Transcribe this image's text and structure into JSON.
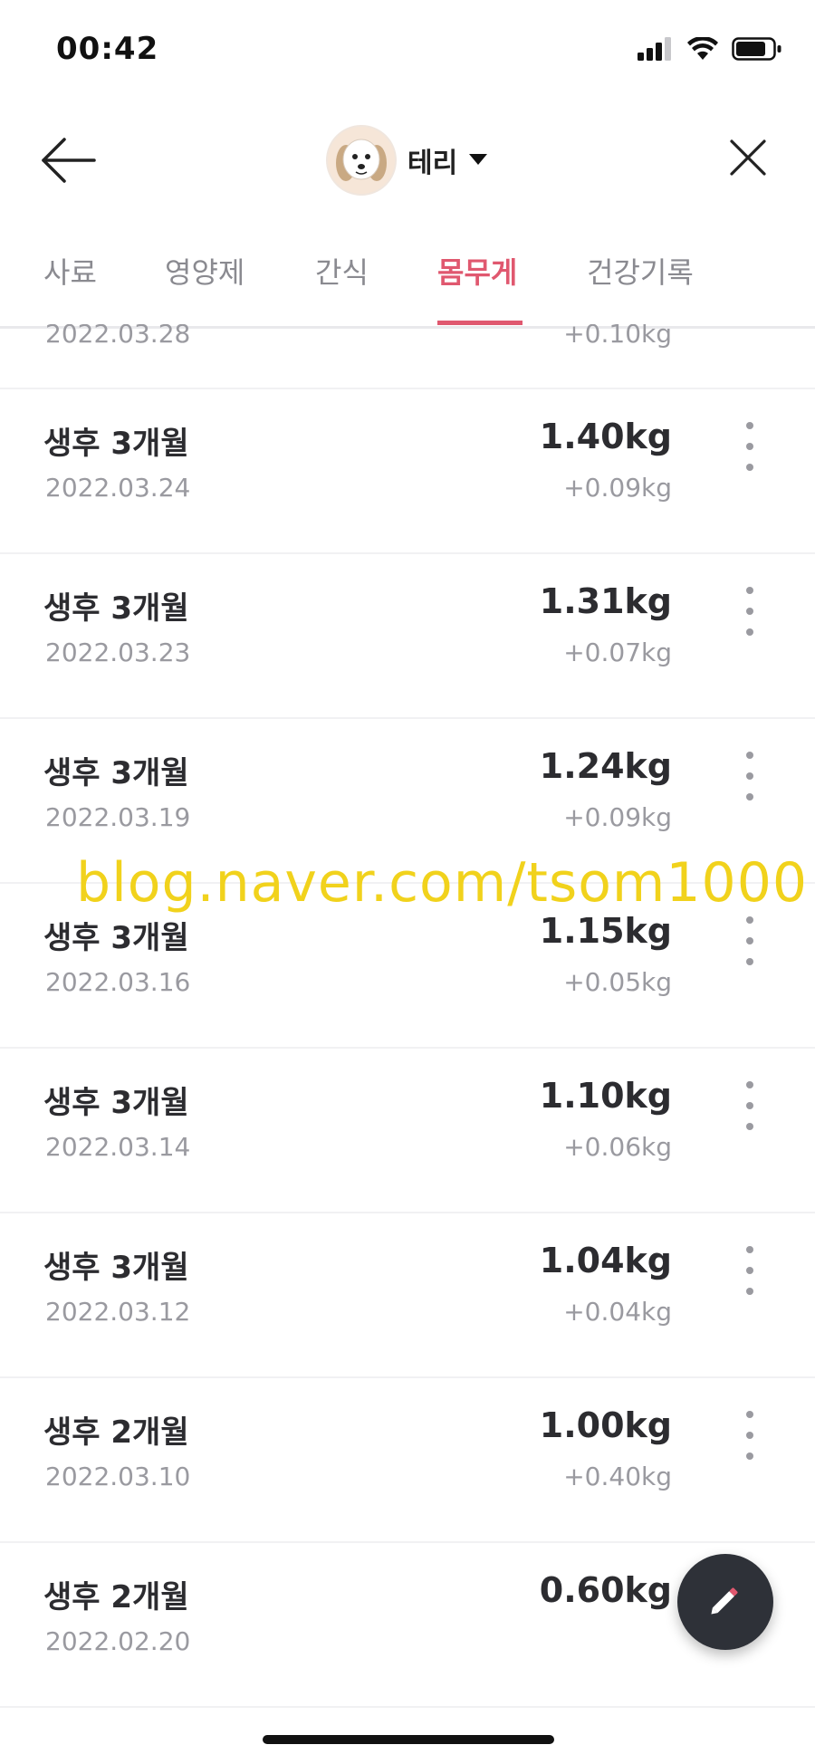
{
  "status_bar": {
    "time": "00:42"
  },
  "header": {
    "pet_name": "테리"
  },
  "tabs": [
    {
      "label": "사료",
      "active": false
    },
    {
      "label": "영양제",
      "active": false
    },
    {
      "label": "간식",
      "active": false
    },
    {
      "label": "몸무게",
      "active": true
    },
    {
      "label": "건강기록",
      "active": false
    }
  ],
  "partial_record": {
    "date": "2022.03.28",
    "change": "+0.10kg"
  },
  "records": [
    {
      "age": "생후 3개월",
      "date": "2022.03.24",
      "weight": "1.40kg",
      "change": "+0.09kg"
    },
    {
      "age": "생후 3개월",
      "date": "2022.03.23",
      "weight": "1.31kg",
      "change": "+0.07kg"
    },
    {
      "age": "생후 3개월",
      "date": "2022.03.19",
      "weight": "1.24kg",
      "change": "+0.09kg"
    },
    {
      "age": "생후 3개월",
      "date": "2022.03.16",
      "weight": "1.15kg",
      "change": "+0.05kg"
    },
    {
      "age": "생후 3개월",
      "date": "2022.03.14",
      "weight": "1.10kg",
      "change": "+0.06kg"
    },
    {
      "age": "생후 3개월",
      "date": "2022.03.12",
      "weight": "1.04kg",
      "change": "+0.04kg"
    },
    {
      "age": "생후 2개월",
      "date": "2022.03.10",
      "weight": "1.00kg",
      "change": "+0.40kg"
    },
    {
      "age": "생후 2개월",
      "date": "2022.02.20",
      "weight": "0.60kg",
      "change": ""
    }
  ],
  "watermark": "blog.naver.com/tsom1000",
  "colors": {
    "accent": "#e0586f",
    "fab": "#2e3138",
    "fab_icon_tip": "#e0586f",
    "watermark": "#f1d21c"
  },
  "icons": {
    "back": "arrow-left-icon",
    "close": "close-icon",
    "more": "more-vertical-icon",
    "dropdown": "caret-down-icon",
    "fab": "pencil-icon"
  }
}
